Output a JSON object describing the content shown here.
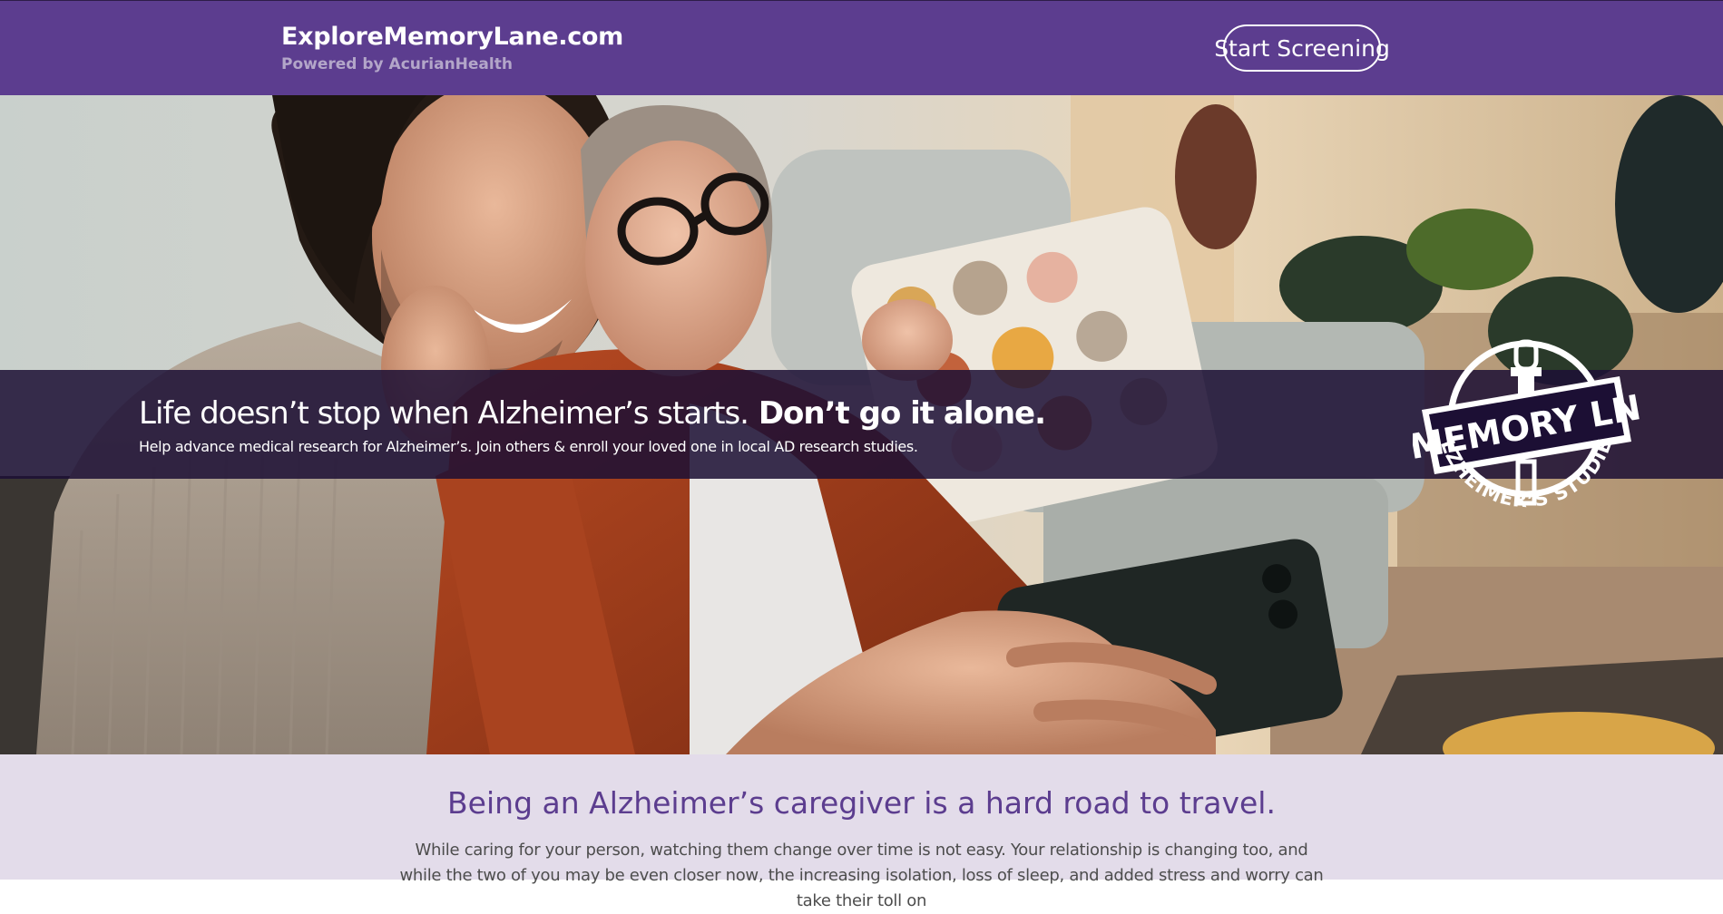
{
  "header": {
    "site_title": "ExploreMemoryLane.com",
    "powered_by": "Powered by AcurianHealth",
    "cta_label": "Start Screening"
  },
  "hero": {
    "headline_light": "Life doesn’t stop when Alzheimer’s starts.",
    "headline_strong": "Don’t go it alone.",
    "subheadline": "Help advance medical research for Alzheimer’s. Join others & enroll your loved one in local AD research studies.",
    "image_alt": "Young man and older woman smiling while taking a selfie on a couch",
    "logo": {
      "top_text": "MEMORY LN",
      "bottom_text": "ALZHEIMER’S STUDIES",
      "icon": "street-sign-logo"
    }
  },
  "section": {
    "heading": "Being an Alzheimer’s caregiver is a hard road to travel.",
    "body": "While caring for your person, watching them change over time is not easy. Your relationship is changing too, and while the two of you may be even closer now, the increasing isolation, loss of sleep, and added stress and worry can take their toll on"
  },
  "colors": {
    "brand_purple": "#5c3d8f",
    "overlay_band": "#1c0f34",
    "section_bg": "#e3dcea",
    "body_text": "#4d4d4d"
  }
}
